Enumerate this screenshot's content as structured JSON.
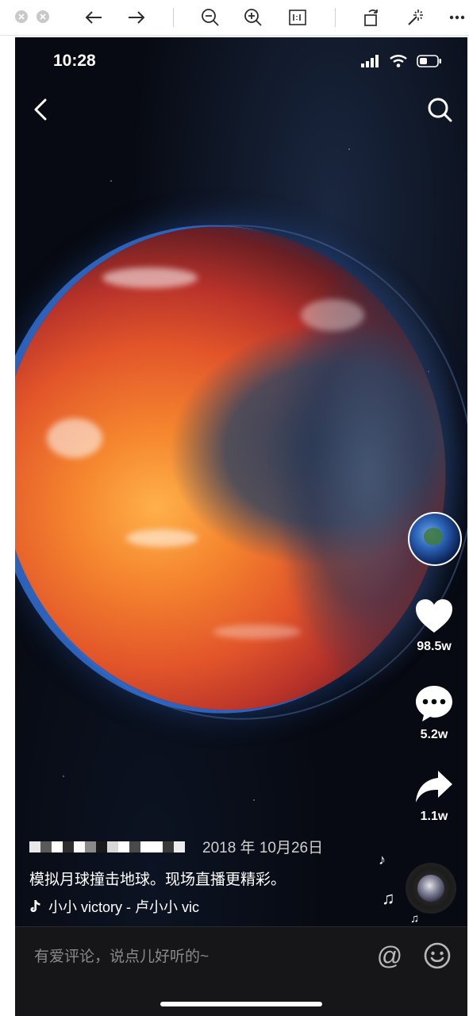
{
  "phone": {
    "status_time": "10:28",
    "caption": {
      "date": "2018 年 10月26日",
      "text": "模拟月球撞击地球。现场直播更精彩。",
      "music": "小小   victory - 卢小小   vic"
    },
    "stats": {
      "likes": "98.5w",
      "comments": "5.2w",
      "shares": "1.1w"
    },
    "comment_placeholder": "有爱评论，说点儿好听的~",
    "at_symbol": "@"
  },
  "icons": {
    "viewer": [
      "close-window-icon",
      "minimize-window-icon",
      "back-arrow-icon",
      "forward-arrow-icon",
      "zoom-out-icon",
      "zoom-in-icon",
      "actual-size-icon",
      "rotate-icon",
      "magic-wand-icon",
      "more-icon"
    ],
    "nav": [
      "back-chevron-icon",
      "search-icon"
    ],
    "rail": [
      "heart-icon",
      "comment-icon",
      "share-icon",
      "music-note-icon"
    ]
  },
  "colors": {
    "background": "#05070d",
    "comment_bar": "#161618",
    "text_primary": "#ffffff",
    "text_secondary": "#8a8a8e"
  }
}
